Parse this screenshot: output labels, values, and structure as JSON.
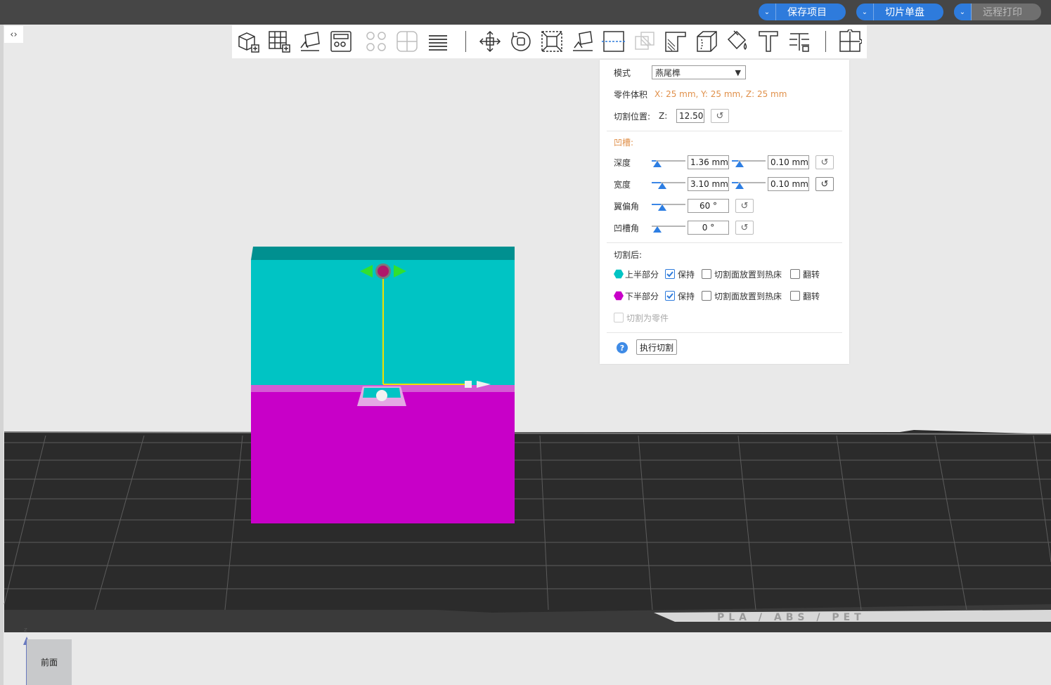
{
  "topbar": {
    "save_project": "保存项目",
    "slice_plate": "切片单盘",
    "remote_print": "远程打印"
  },
  "panel": {
    "mode_label": "模式",
    "mode_value": "燕尾榫",
    "volume_label": "零件体积",
    "volume_value": "X: 25 mm,  Y: 25 mm,  Z: 25 mm",
    "cut_pos_label": "切割位置:",
    "cut_pos_axis": "Z:",
    "cut_pos_value": "12.50",
    "groove_header": "凹槽:",
    "depth_label": "深度",
    "depth_value": "1.36  mm",
    "depth_tol": "0.10  mm",
    "width_label": "宽度",
    "width_value": "3.10  mm",
    "width_tol": "0.10  mm",
    "flap_label": "翼偏角",
    "flap_value": "60 °",
    "groove_angle_label": "凹槽角",
    "groove_angle_value": "0 °",
    "after_cut_label": "切割后:",
    "upper_label": "上半部分",
    "lower_label": "下半部分",
    "keep_label": "保持",
    "place_on_bed_label": "切割面放置到热床",
    "flip_label": "翻转",
    "cut_to_parts_label": "切割为零件",
    "execute_label": "执行切割",
    "help_glyph": "?"
  },
  "colors": {
    "upper": "#00c4c4",
    "lower": "#c800c8",
    "accent": "#2e7bdc"
  },
  "sliders": {
    "depth_fraction": 0.13,
    "depth_tol_fraction": 0.18,
    "width_fraction": 0.28,
    "width_tol_fraction": 0.18,
    "flap_fraction": 0.28,
    "groove_angle_fraction": 0.0
  },
  "viewcube": {
    "face": "前面",
    "axis": "z"
  },
  "plate_text": "PLA / ABS / PET"
}
